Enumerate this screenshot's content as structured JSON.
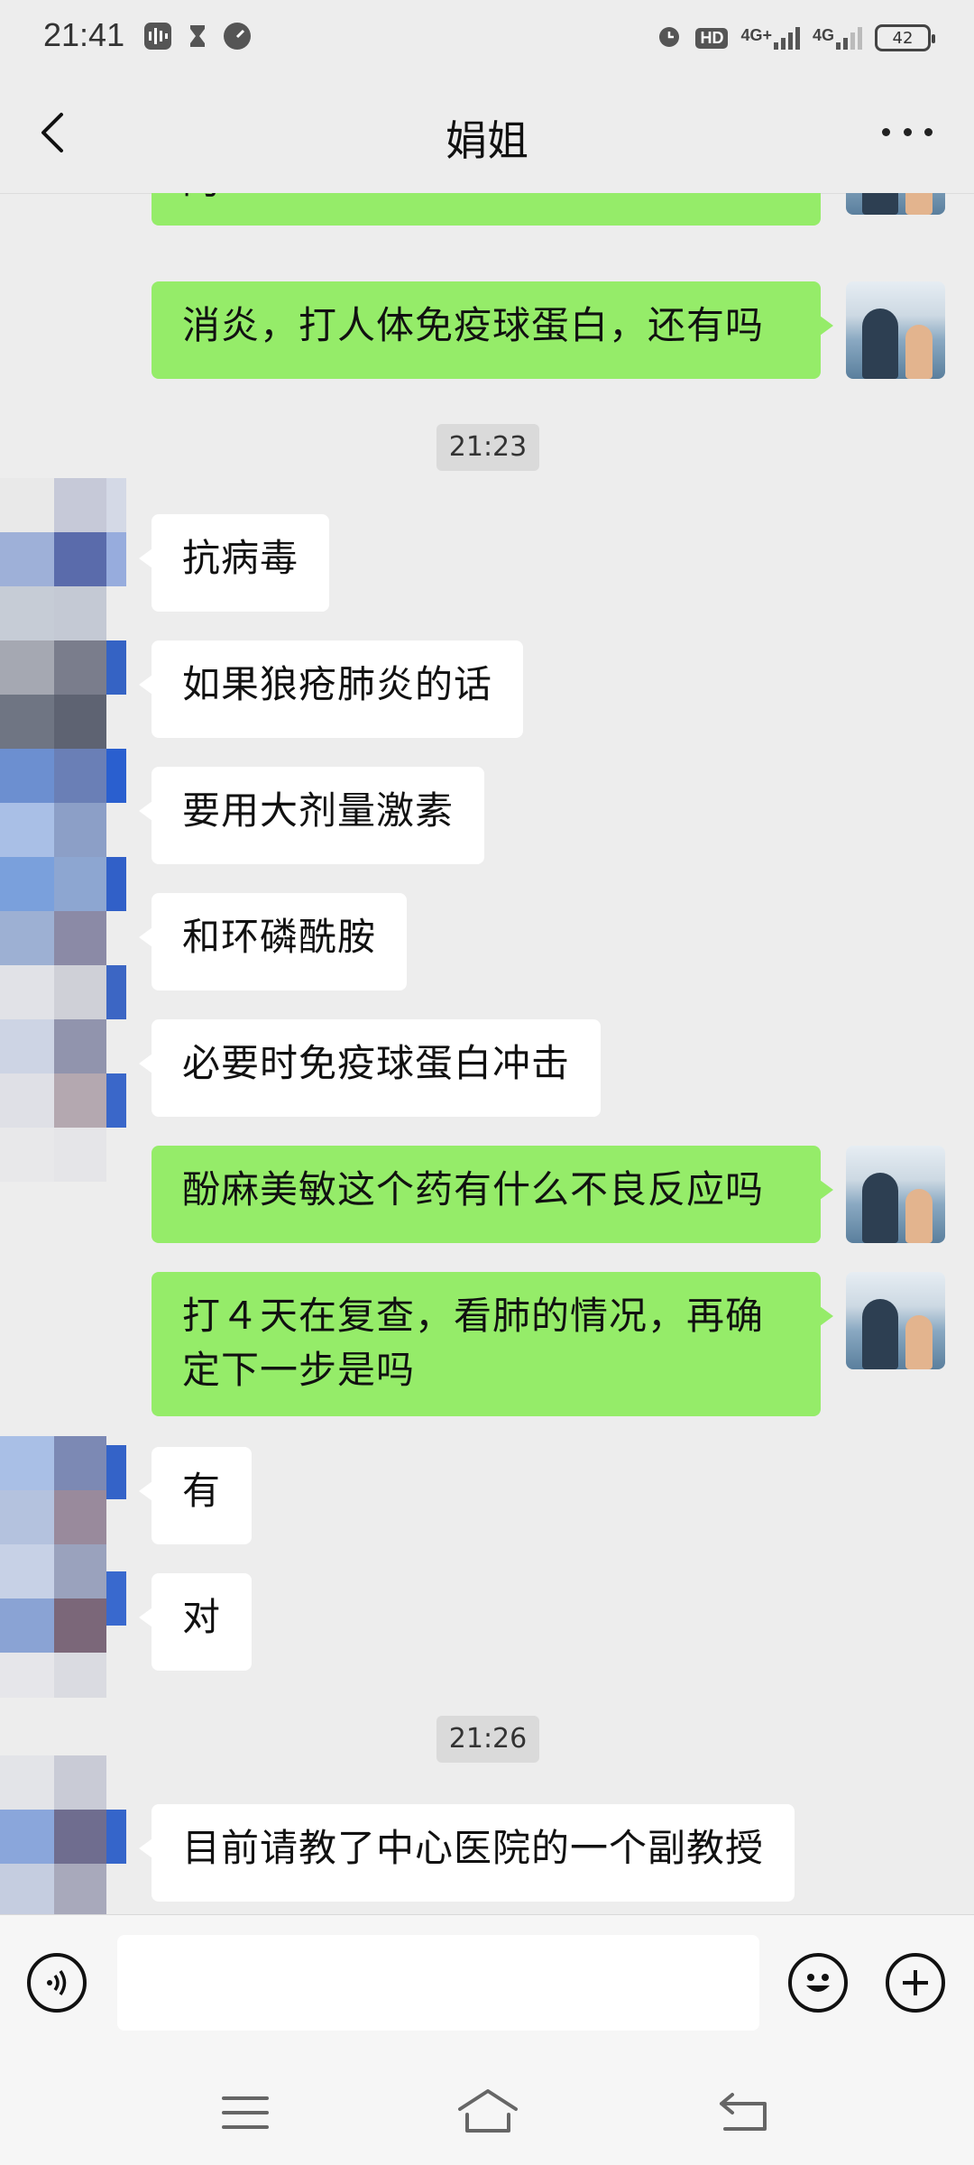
{
  "status_bar": {
    "time": "21:41",
    "icons": [
      "voice-memo-icon",
      "hourglass-icon",
      "speedometer-icon",
      "alarm-icon",
      "hd-icon",
      "signal-4g-plus-icon",
      "signal-4g-icon",
      "battery-icon"
    ],
    "hd_label": "HD",
    "net1": "4G+",
    "net2": "4G",
    "battery_level": "42"
  },
  "header": {
    "title": "娟姐"
  },
  "messages": [
    {
      "side": "out",
      "text": "的"
    },
    {
      "side": "out",
      "text": "消炎，打人体免疫球蛋白，还有吗"
    },
    {
      "side": "in",
      "text": "抗病毒"
    },
    {
      "side": "in",
      "text": "如果狼疮肺炎的话"
    },
    {
      "side": "in",
      "text": "要用大剂量激素"
    },
    {
      "side": "in",
      "text": "和环磷酰胺"
    },
    {
      "side": "in",
      "text": "必要时免疫球蛋白冲击"
    },
    {
      "side": "out",
      "text": "酚麻美敏这个药有什么不良反应吗"
    },
    {
      "side": "out",
      "text": "打４天在复查，看肺的情况，再确定下一步是吗"
    },
    {
      "side": "in",
      "text": "有"
    },
    {
      "side": "in",
      "text": "对"
    },
    {
      "side": "in",
      "text": "目前请教了中心医院的一个副教授"
    }
  ],
  "timestamps": [
    "21:23",
    "21:26"
  ],
  "input_bar": {
    "text_value": "",
    "voice_icon": "voice-input-icon",
    "emoji_icon": "emoji-icon",
    "plus_icon": "plus-icon"
  },
  "nav_bar": {
    "icons": [
      "menu-icon",
      "home-icon",
      "back-nav-icon"
    ]
  },
  "colors": {
    "outgoing_bubble": "#95ec69",
    "incoming_bubble": "#ffffff",
    "chat_background": "#ededed"
  }
}
